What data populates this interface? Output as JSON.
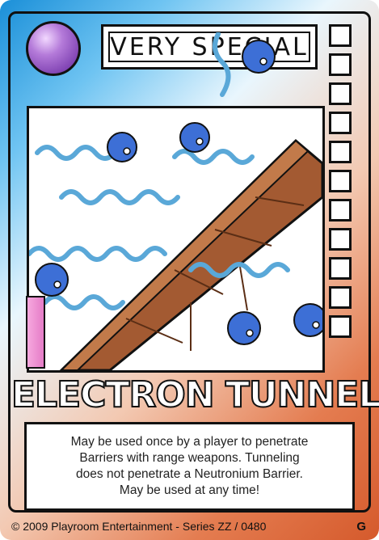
{
  "card": {
    "type_label": "VERY SPECIAL",
    "title": "ELECTRON TUNNELING",
    "description_lines": [
      "May be used once by a player to penetrate",
      "Barriers with range weapons.  Tunneling",
      "does not penetrate a Neutronium Barrier.",
      "May be used at any time!"
    ],
    "copyright": "© 2009 Playroom Entertainment - Series ZZ / 0480",
    "card_code": "G",
    "orb_icon": "purple-orb-icon",
    "colors": {
      "blue_edge": "#1a8fd8",
      "orange_edge": "#d55a2c",
      "orb": "#9b59c9",
      "electron": "#3d6fd6",
      "wave": "#5aa8d8",
      "barrier": "#a35a32"
    }
  }
}
